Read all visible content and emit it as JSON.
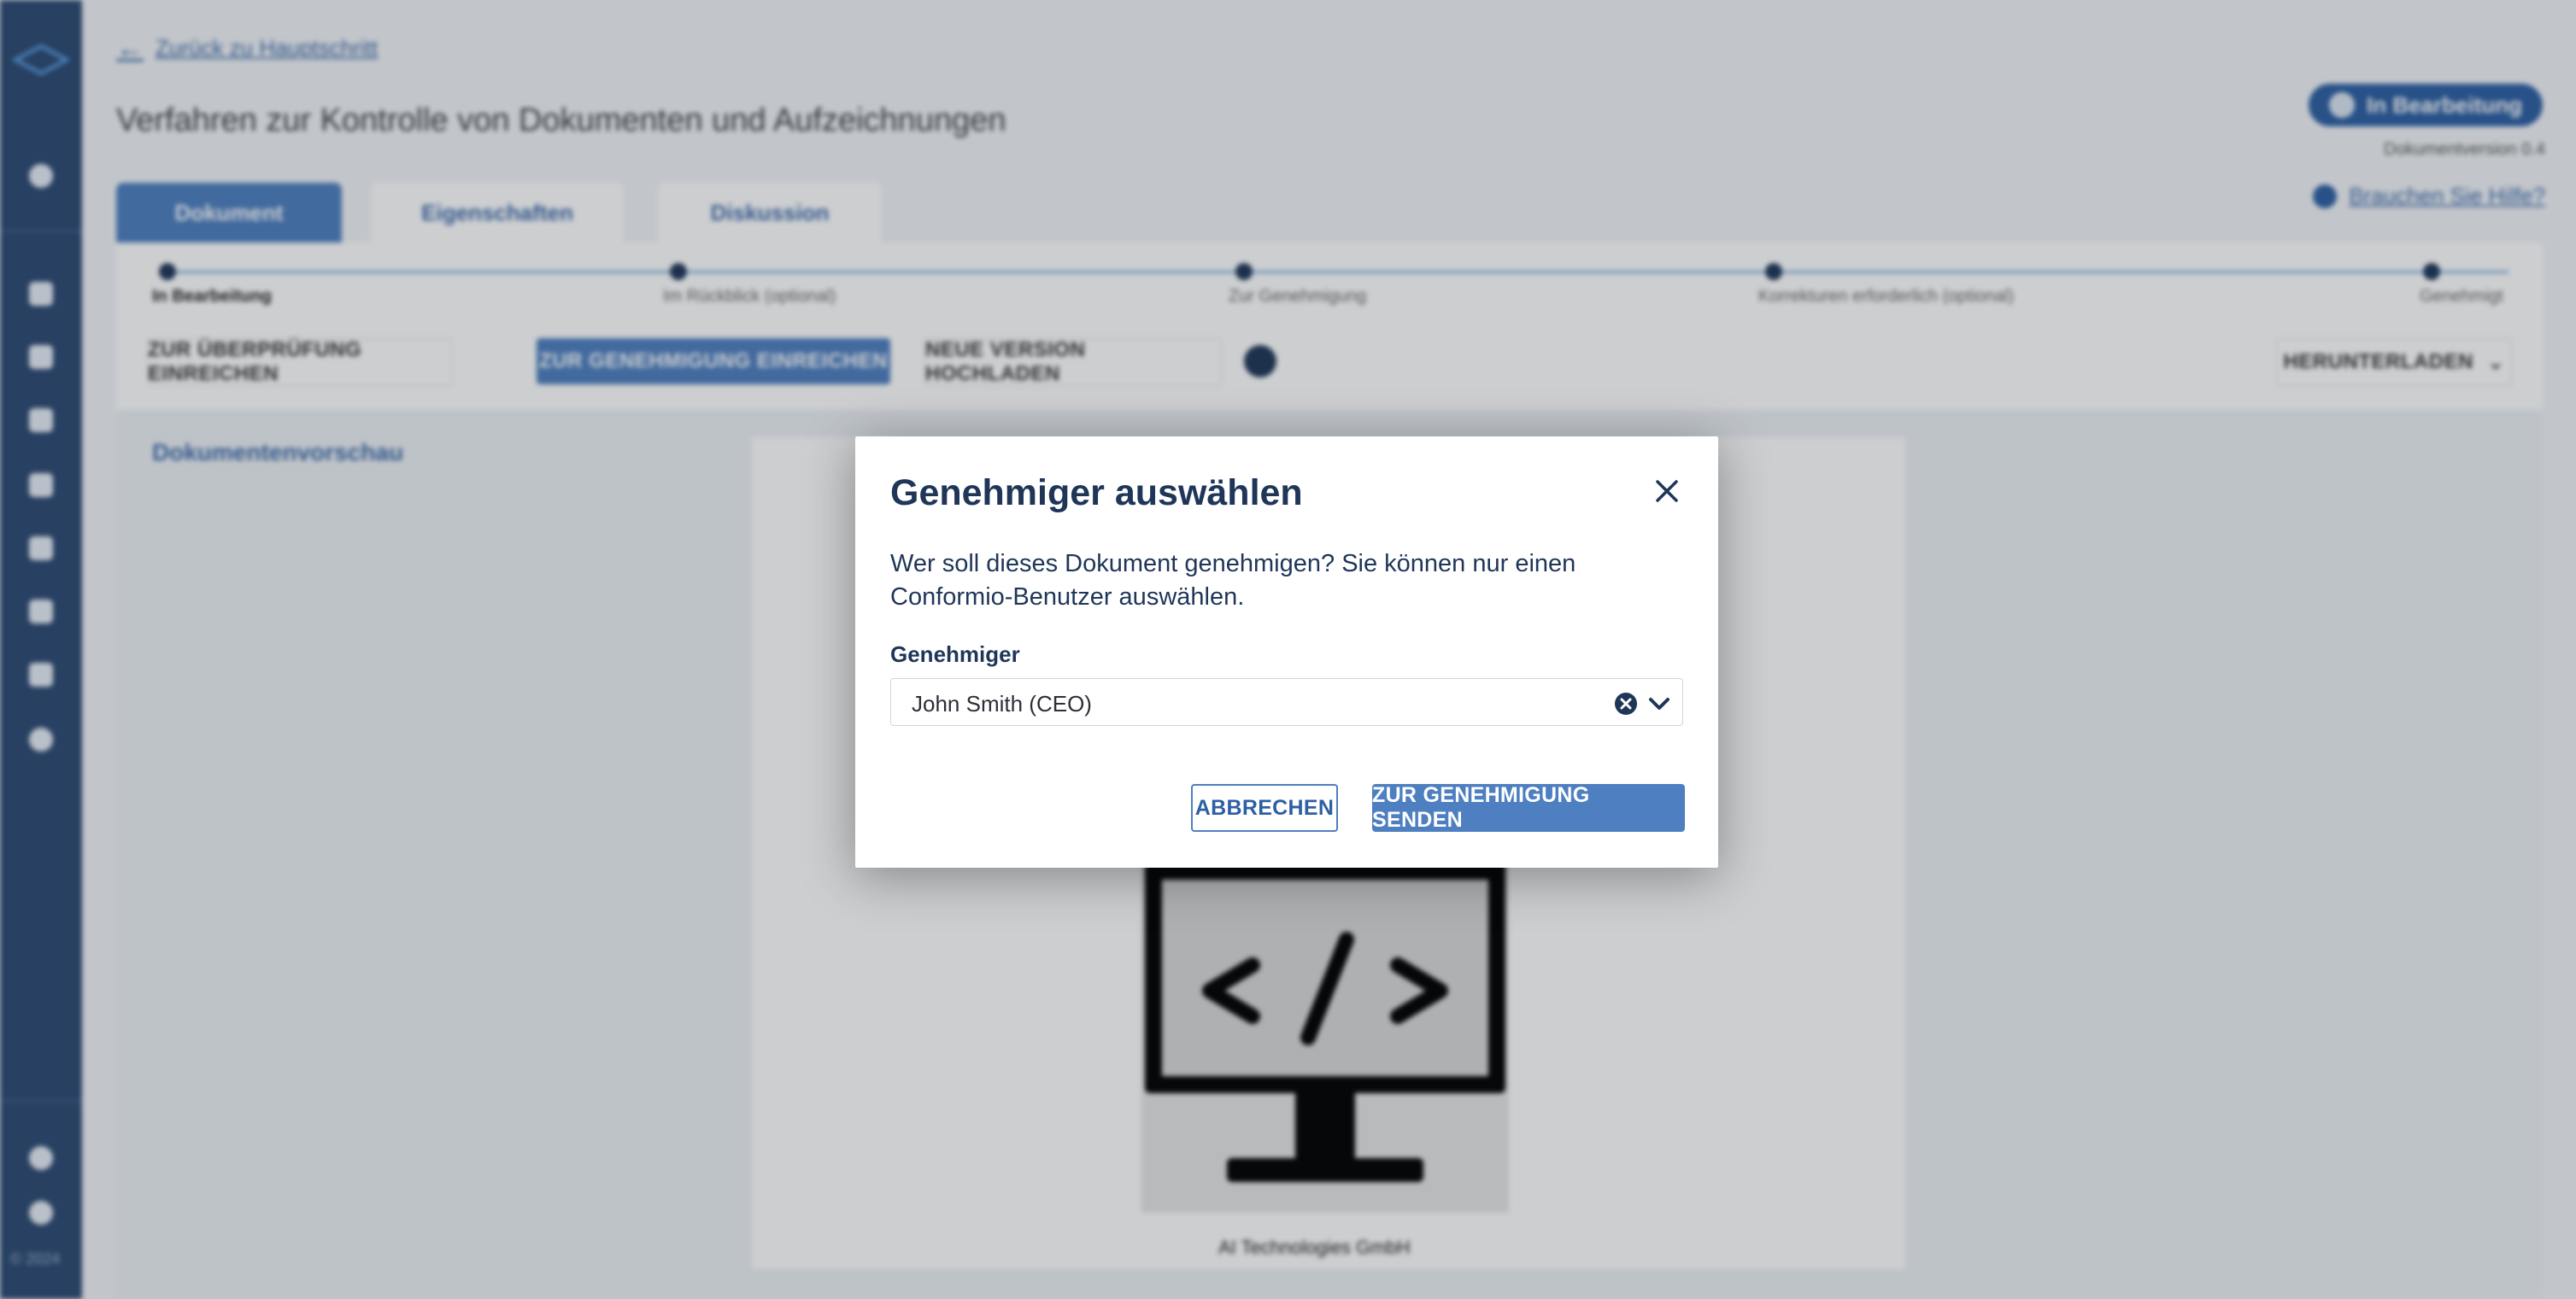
{
  "colors": {
    "sidebar_bg": "#2d4a73",
    "primary": "#4e7fc0",
    "title_text": "#1f3658",
    "status_pill": "#2d5fa3"
  },
  "sidebar": {
    "icons": [
      "logo-icon",
      "shield-icon",
      "home-icon",
      "folder-icon",
      "database-icon",
      "document-icon",
      "dashboard-icon",
      "checklist-icon",
      "graduation-cap-icon",
      "gear-icon",
      "help-icon",
      "user-icon"
    ],
    "copyright": "© 2024"
  },
  "header": {
    "back_link": "Zurück zu Hauptschritt",
    "page_title": "Verfahren zur Kontrolle von Dokumenten und Aufzeichnungen",
    "status": "In Bearbeitung",
    "document_version": "Dokumentversion 0.4",
    "help_link": "Brauchen Sie Hilfe?"
  },
  "tabs": [
    {
      "label": "Dokument",
      "active": true
    },
    {
      "label": "Eigenschaften",
      "active": false
    },
    {
      "label": "Diskussion",
      "active": false
    }
  ],
  "workflow": {
    "steps": [
      {
        "label": "In Bearbeitung",
        "active": true
      },
      {
        "label": "Im Rückblick (optional)",
        "active": false
      },
      {
        "label": "Zur Genehmigung",
        "active": false
      },
      {
        "label": "Korrekturen erforderlich (optional)",
        "active": false
      },
      {
        "label": "Genehmigt",
        "active": false
      }
    ],
    "buttons": {
      "submit_review": "ZUR ÜBERPRÜFUNG EINREICHEN",
      "submit_approval": "ZUR GENEHMIGUNG EINREICHEN",
      "upload_version": "NEUE VERSION HOCHLADEN",
      "download": "HERUNTERLADEN"
    }
  },
  "preview": {
    "heading": "Dokumentenvorschau",
    "company": "AI Technologies GmbH"
  },
  "modal": {
    "title": "Genehmiger auswählen",
    "description": "Wer soll dieses Dokument genehmigen? Sie können nur einen Conformio-Benutzer auswählen.",
    "field_label": "Genehmiger",
    "selected_value": "John Smith (CEO)",
    "cancel_label": "ABBRECHEN",
    "submit_label": "ZUR GENEHMIGUNG SENDEN"
  }
}
